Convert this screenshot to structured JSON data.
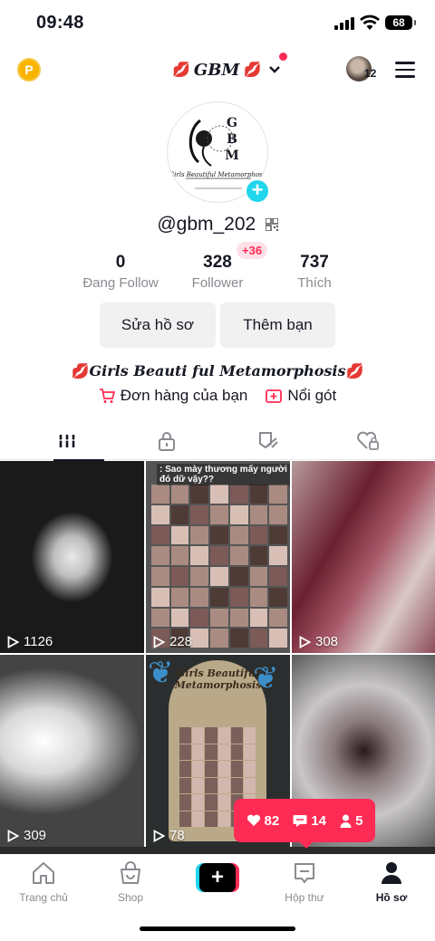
{
  "status_bar": {
    "time": "09:48",
    "battery": "68"
  },
  "header": {
    "account_name": "GBM",
    "lips_emoji": "💋",
    "avatar_count": "12"
  },
  "profile": {
    "logo_letters": [
      "G",
      "B",
      "M"
    ],
    "logo_subtitle": "Girls Beautiful Metamorphosis",
    "handle": "@gbm_202",
    "stats": {
      "following": {
        "value": "0",
        "label": "Đang Follow"
      },
      "followers": {
        "value": "328",
        "label": "Follower",
        "badge": "+36"
      },
      "likes": {
        "value": "737",
        "label": "Thích"
      }
    },
    "buttons": {
      "edit": "Sửa hồ sơ",
      "add_friend": "Thêm bạn"
    },
    "bio": "Girls Beauti ful Metamorphosis",
    "links": {
      "orders": "Đơn hàng của bạn",
      "showcase": "Nổi gót"
    }
  },
  "tabs": [
    "videos",
    "private",
    "reposts",
    "liked"
  ],
  "videos": [
    {
      "views": "1126"
    },
    {
      "views": "228",
      "caption": ": Sao mày thương mấy người đó dữ vậy??"
    },
    {
      "views": "308"
    },
    {
      "views": "309"
    },
    {
      "views": "78",
      "caption": "Girls Beautiful Metamorphosis"
    },
    {
      "views": ""
    }
  ],
  "notification": {
    "likes": "82",
    "comments": "14",
    "followers": "5"
  },
  "nav": {
    "home": "Trang chủ",
    "shop": "Shop",
    "inbox": "Hộp thư",
    "profile": "Hồ sơ"
  },
  "colors": {
    "accent": "#fe2c55",
    "secondary": "#20d5ec",
    "text": "#161823",
    "muted": "#8a8b91"
  }
}
